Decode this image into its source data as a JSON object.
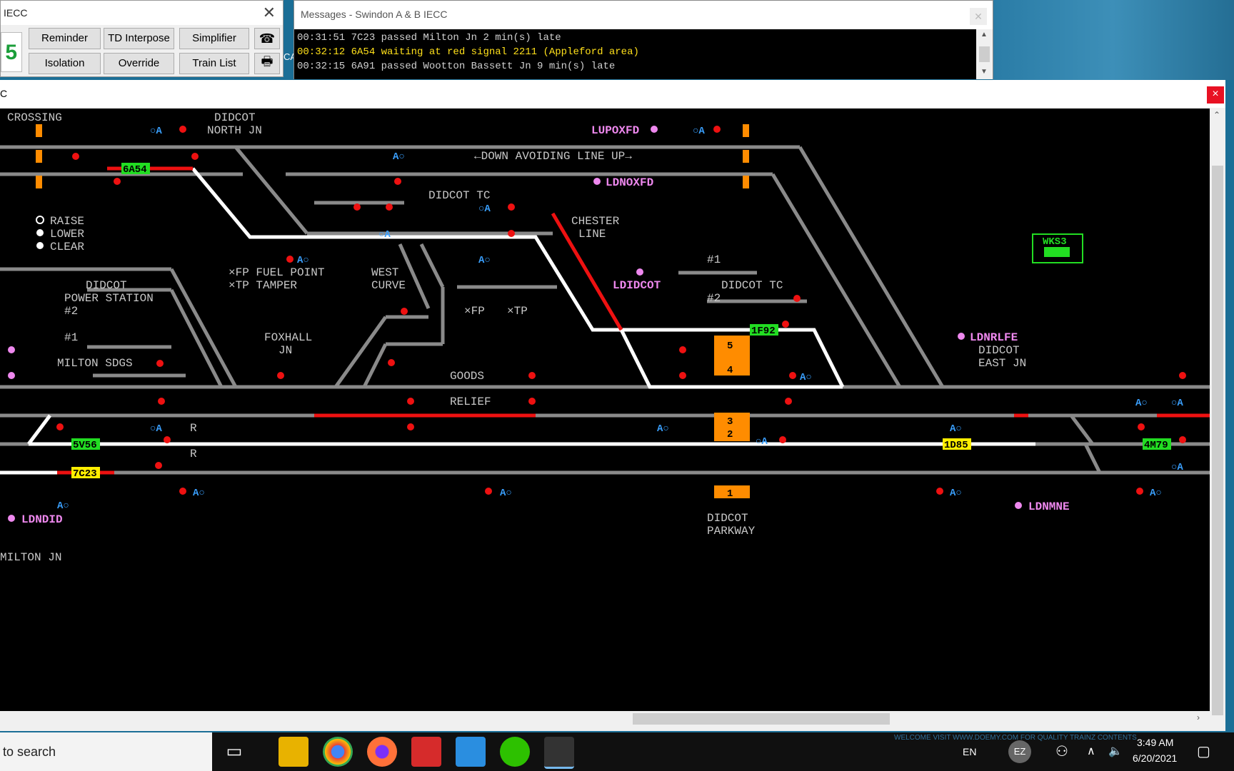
{
  "control_window": {
    "title": "IECC",
    "big_number": "5",
    "buttons": [
      "Reminder",
      "TD Interpose",
      "Simplifier",
      "Isolation",
      "Override",
      "Train List"
    ]
  },
  "messages_window": {
    "title": "Messages - Swindon A & B IECC",
    "overflow_label": "CA",
    "lines": [
      "00:31:51 7C23 passed Milton Jn 2 min(s) late",
      "00:32:12 6A54 waiting at red signal 2211 (Appleford area)",
      "00:32:15 6A91 passed Wootton Bassett Jn 9 min(s) late"
    ]
  },
  "main_window": {
    "title": "C",
    "labels": {
      "crossing": "CROSSING",
      "didcot_north_jn": [
        "DIDCOT",
        "NORTH JN"
      ],
      "down_avoiding": "←DOWN AVOIDING LINE UP→",
      "didcot_tc": "DIDCOT TC",
      "chester_line": [
        "CHESTER",
        "LINE"
      ],
      "raise": "RAISE",
      "lower": "LOWER",
      "clear": "CLEAR",
      "fuel_point": "×FP FUEL POINT",
      "tamper": "×TP TAMPER",
      "west_curve": [
        "WEST",
        "CURVE"
      ],
      "fp": "×FP",
      "tp": "×TP",
      "power_station": [
        "DIDCOT",
        "POWER STATION"
      ],
      "milton_sdgs": "MILTON SDGS",
      "foxhall_jn": [
        "FOXHALL",
        "JN"
      ],
      "goods": "GOODS",
      "relief": "RELIEF",
      "didcot_tc2": "DIDCOT TC",
      "didcot_east_jn": [
        "DIDCOT",
        "EAST JN"
      ],
      "didcot_parkway": [
        "DIDCOT",
        "PARKWAY"
      ],
      "milton_jn": "MILTON JN",
      "n1": "#1",
      "n2": "#2",
      "r": "R",
      "ao": "A○",
      "oa": "○A"
    },
    "locations": {
      "lupoxfd": "LUPOXFD",
      "ldnoxfd": "LDNOXFD",
      "ldidcot": "LDIDCOT",
      "ldnrlfe": "LDNRLFE",
      "ldndid": "LDNDID",
      "ldnmne": "LDNMNE"
    },
    "platforms": [
      "5",
      "4",
      "3",
      "2",
      "1"
    ],
    "train_descriptions": {
      "t6a54": "6A54",
      "t5v56": "5V56",
      "t7c23": "7C23",
      "t1f92": "1F92",
      "t1d85": "1D85",
      "t4m79": "4M79",
      "wks": "WKS3"
    }
  },
  "taskbar": {
    "search_text": "to search",
    "language": "EN",
    "user_initials": "EZ",
    "time": "3:49 AM",
    "date": "6/20/2021",
    "ticker": "WELCOME VISIT WWW.DOEMY.COM FOR QUALITY TRAINZ CONTENTS"
  },
  "colors": {
    "track": "#8a8a8a",
    "route": "#ffffff",
    "occupied": "#ee1111",
    "td_green": "#22dd22",
    "td_yellow": "#ffee00",
    "platform": "#ff8c00",
    "signal_red": "#ee1111",
    "blue": "#3aa0ff",
    "pink": "#ee88ee"
  }
}
